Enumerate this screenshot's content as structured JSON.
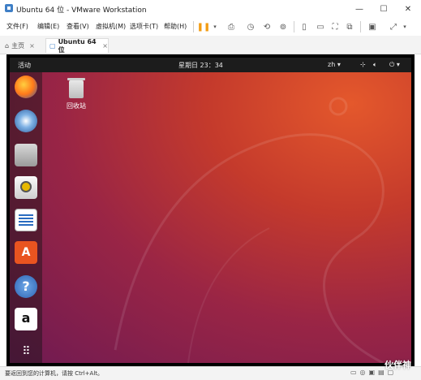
{
  "window": {
    "title": "Ubuntu 64 位 - VMware Workstation"
  },
  "menu": [
    "文件(F)",
    "编辑(E)",
    "查看(V)",
    "虚拟机(M)",
    "选项卡(T)",
    "帮助(H)"
  ],
  "tabs": {
    "home": "主页",
    "vm": "Ubuntu 64 位",
    "close": "×"
  },
  "ubuntu": {
    "activities": "活动",
    "clock": "星期日 23：34",
    "lang": "zh ▾",
    "power": "⏻ ▾",
    "trash_label": "回收站"
  },
  "status": {
    "text": "要返回到您的计算机，请按 Ctrl+Alt。"
  },
  "watermark": "伙伴神",
  "colors": {
    "accent": "#3f7fc6",
    "pause": "#f39c12",
    "ubuntu_orange": "#e95420",
    "topbar": "#1c1c1c"
  }
}
